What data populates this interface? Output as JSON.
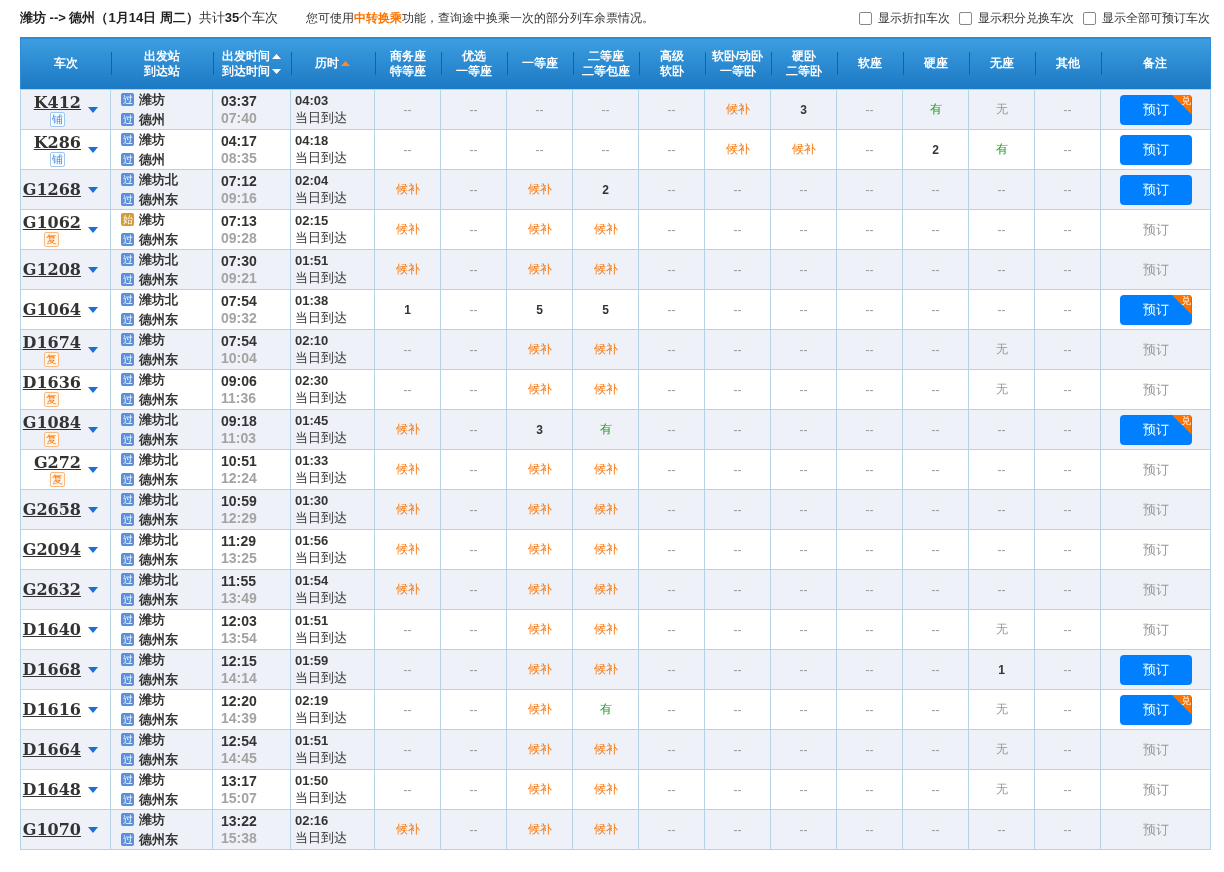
{
  "summary": "**潍坊 --> 德州（1月14日  周二）**共计**35**个车次",
  "notice": {
    "before": "您可使用",
    "link": "中转换乘",
    "after": "功能，查询途中换乘一次的部分列车余票情况。"
  },
  "filters": [
    {
      "label": "显示折扣车次",
      "checked": false
    },
    {
      "label": "显示积分兑换车次",
      "checked": false
    },
    {
      "label": "显示全部可预订车次",
      "checked": false
    }
  ],
  "columns": [
    {
      "lines": [
        "车次"
      ],
      "sortable": false,
      "sorted": false
    },
    {
      "lines": [
        "出发站",
        "到达站"
      ],
      "sortable": false,
      "sorted": false
    },
    {
      "lines": [
        "出发时间",
        "到达时间"
      ],
      "sortable": true,
      "sorted": false
    },
    {
      "lines": [
        "历时"
      ],
      "sortable": false,
      "sorted": true
    },
    {
      "lines": [
        "商务座",
        "特等座"
      ],
      "sortable": false,
      "sorted": false
    },
    {
      "lines": [
        "优选",
        "一等座"
      ],
      "sortable": false,
      "sorted": false
    },
    {
      "lines": [
        "一等座"
      ],
      "sortable": false,
      "sorted": false
    },
    {
      "lines": [
        "二等座",
        "二等包座"
      ],
      "sortable": false,
      "sorted": false
    },
    {
      "lines": [
        "高级",
        "软卧"
      ],
      "sortable": false,
      "sorted": false
    },
    {
      "lines": [
        "软卧/动卧",
        "一等卧"
      ],
      "sortable": false,
      "sorted": false
    },
    {
      "lines": [
        "硬卧",
        "二等卧"
      ],
      "sortable": false,
      "sorted": false
    },
    {
      "lines": [
        "软座"
      ],
      "sortable": false,
      "sorted": false
    },
    {
      "lines": [
        "硬座"
      ],
      "sortable": false,
      "sorted": false
    },
    {
      "lines": [
        "无座"
      ],
      "sortable": false,
      "sorted": false
    },
    {
      "lines": [
        "其他"
      ],
      "sortable": false,
      "sorted": false
    },
    {
      "lines": [
        "备注"
      ],
      "sortable": false,
      "sorted": false
    }
  ],
  "rows": [
    {
      "train": "K412",
      "badge": {
        "text": "铺",
        "kind": "sleeper"
      },
      "from": {
        "tag": "过",
        "kind": "pass",
        "name": "潍坊"
      },
      "to": {
        "tag": "过",
        "kind": "pass",
        "name": "德州"
      },
      "depart": "03:37",
      "arrive": "07:40",
      "duration": "04:03",
      "arrival_day": "当日到达",
      "seats": [
        {
          "text": "--",
          "kind": "none"
        },
        {
          "text": "--",
          "kind": "none"
        },
        {
          "text": "--",
          "kind": "none"
        },
        {
          "text": "--",
          "kind": "none"
        },
        {
          "text": "--",
          "kind": "none"
        },
        {
          "text": "候补",
          "kind": "waitlist"
        },
        {
          "text": "3",
          "kind": "count"
        },
        {
          "text": "--",
          "kind": "none"
        },
        {
          "text": "有",
          "kind": "plenty"
        },
        {
          "text": "无",
          "kind": "soldout"
        },
        {
          "text": "--",
          "kind": "none"
        }
      ],
      "booking": {
        "label": "预订",
        "enabled": true,
        "exchange": true,
        "exchange_label": "兑"
      }
    },
    {
      "train": "K286",
      "badge": {
        "text": "铺",
        "kind": "sleeper"
      },
      "from": {
        "tag": "过",
        "kind": "pass",
        "name": "潍坊"
      },
      "to": {
        "tag": "过",
        "kind": "pass",
        "name": "德州"
      },
      "depart": "04:17",
      "arrive": "08:35",
      "duration": "04:18",
      "arrival_day": "当日到达",
      "seats": [
        {
          "text": "--",
          "kind": "none"
        },
        {
          "text": "--",
          "kind": "none"
        },
        {
          "text": "--",
          "kind": "none"
        },
        {
          "text": "--",
          "kind": "none"
        },
        {
          "text": "--",
          "kind": "none"
        },
        {
          "text": "候补",
          "kind": "waitlist"
        },
        {
          "text": "候补",
          "kind": "waitlist"
        },
        {
          "text": "--",
          "kind": "none"
        },
        {
          "text": "2",
          "kind": "count"
        },
        {
          "text": "有",
          "kind": "plenty"
        },
        {
          "text": "--",
          "kind": "none"
        }
      ],
      "booking": {
        "label": "预订",
        "enabled": true,
        "exchange": false
      }
    },
    {
      "train": "G1268",
      "from": {
        "tag": "过",
        "kind": "pass",
        "name": "潍坊北"
      },
      "to": {
        "tag": "过",
        "kind": "pass",
        "name": "德州东"
      },
      "depart": "07:12",
      "arrive": "09:16",
      "duration": "02:04",
      "arrival_day": "当日到达",
      "seats": [
        {
          "text": "候补",
          "kind": "waitlist"
        },
        {
          "text": "--",
          "kind": "none"
        },
        {
          "text": "候补",
          "kind": "waitlist"
        },
        {
          "text": "2",
          "kind": "count"
        },
        {
          "text": "--",
          "kind": "none"
        },
        {
          "text": "--",
          "kind": "none"
        },
        {
          "text": "--",
          "kind": "none"
        },
        {
          "text": "--",
          "kind": "none"
        },
        {
          "text": "--",
          "kind": "none"
        },
        {
          "text": "--",
          "kind": "none"
        },
        {
          "text": "--",
          "kind": "none"
        }
      ],
      "booking": {
        "label": "预订",
        "enabled": true,
        "exchange": false
      }
    },
    {
      "train": "G1062",
      "badge": {
        "text": "复",
        "kind": "resume"
      },
      "from": {
        "tag": "始",
        "kind": "origin",
        "name": "潍坊"
      },
      "to": {
        "tag": "过",
        "kind": "pass",
        "name": "德州东"
      },
      "depart": "07:13",
      "arrive": "09:28",
      "duration": "02:15",
      "arrival_day": "当日到达",
      "seats": [
        {
          "text": "候补",
          "kind": "waitlist"
        },
        {
          "text": "--",
          "kind": "none"
        },
        {
          "text": "候补",
          "kind": "waitlist"
        },
        {
          "text": "候补",
          "kind": "waitlist"
        },
        {
          "text": "--",
          "kind": "none"
        },
        {
          "text": "--",
          "kind": "none"
        },
        {
          "text": "--",
          "kind": "none"
        },
        {
          "text": "--",
          "kind": "none"
        },
        {
          "text": "--",
          "kind": "none"
        },
        {
          "text": "--",
          "kind": "none"
        },
        {
          "text": "--",
          "kind": "none"
        }
      ],
      "booking": {
        "label": "预订",
        "enabled": false
      }
    },
    {
      "train": "G1208",
      "from": {
        "tag": "过",
        "kind": "pass",
        "name": "潍坊北"
      },
      "to": {
        "tag": "过",
        "kind": "pass",
        "name": "德州东"
      },
      "depart": "07:30",
      "arrive": "09:21",
      "duration": "01:51",
      "arrival_day": "当日到达",
      "seats": [
        {
          "text": "候补",
          "kind": "waitlist"
        },
        {
          "text": "--",
          "kind": "none"
        },
        {
          "text": "候补",
          "kind": "waitlist"
        },
        {
          "text": "候补",
          "kind": "waitlist"
        },
        {
          "text": "--",
          "kind": "none"
        },
        {
          "text": "--",
          "kind": "none"
        },
        {
          "text": "--",
          "kind": "none"
        },
        {
          "text": "--",
          "kind": "none"
        },
        {
          "text": "--",
          "kind": "none"
        },
        {
          "text": "--",
          "kind": "none"
        },
        {
          "text": "--",
          "kind": "none"
        }
      ],
      "booking": {
        "label": "预订",
        "enabled": false
      }
    },
    {
      "train": "G1064",
      "from": {
        "tag": "过",
        "kind": "pass",
        "name": "潍坊北"
      },
      "to": {
        "tag": "过",
        "kind": "pass",
        "name": "德州东"
      },
      "depart": "07:54",
      "arrive": "09:32",
      "duration": "01:38",
      "arrival_day": "当日到达",
      "seats": [
        {
          "text": "1",
          "kind": "count"
        },
        {
          "text": "--",
          "kind": "none"
        },
        {
          "text": "5",
          "kind": "count"
        },
        {
          "text": "5",
          "kind": "count"
        },
        {
          "text": "--",
          "kind": "none"
        },
        {
          "text": "--",
          "kind": "none"
        },
        {
          "text": "--",
          "kind": "none"
        },
        {
          "text": "--",
          "kind": "none"
        },
        {
          "text": "--",
          "kind": "none"
        },
        {
          "text": "--",
          "kind": "none"
        },
        {
          "text": "--",
          "kind": "none"
        }
      ],
      "booking": {
        "label": "预订",
        "enabled": true,
        "exchange": true,
        "exchange_label": "兑"
      }
    },
    {
      "train": "D1674",
      "badge": {
        "text": "复",
        "kind": "resume"
      },
      "from": {
        "tag": "过",
        "kind": "pass",
        "name": "潍坊"
      },
      "to": {
        "tag": "过",
        "kind": "pass",
        "name": "德州东"
      },
      "depart": "07:54",
      "arrive": "10:04",
      "duration": "02:10",
      "arrival_day": "当日到达",
      "seats": [
        {
          "text": "--",
          "kind": "none"
        },
        {
          "text": "--",
          "kind": "none"
        },
        {
          "text": "候补",
          "kind": "waitlist"
        },
        {
          "text": "候补",
          "kind": "waitlist"
        },
        {
          "text": "--",
          "kind": "none"
        },
        {
          "text": "--",
          "kind": "none"
        },
        {
          "text": "--",
          "kind": "none"
        },
        {
          "text": "--",
          "kind": "none"
        },
        {
          "text": "--",
          "kind": "none"
        },
        {
          "text": "无",
          "kind": "soldout"
        },
        {
          "text": "--",
          "kind": "none"
        }
      ],
      "booking": {
        "label": "预订",
        "enabled": false
      }
    },
    {
      "train": "D1636",
      "badge": {
        "text": "复",
        "kind": "resume"
      },
      "from": {
        "tag": "过",
        "kind": "pass",
        "name": "潍坊"
      },
      "to": {
        "tag": "过",
        "kind": "pass",
        "name": "德州东"
      },
      "depart": "09:06",
      "arrive": "11:36",
      "duration": "02:30",
      "arrival_day": "当日到达",
      "seats": [
        {
          "text": "--",
          "kind": "none"
        },
        {
          "text": "--",
          "kind": "none"
        },
        {
          "text": "候补",
          "kind": "waitlist"
        },
        {
          "text": "候补",
          "kind": "waitlist"
        },
        {
          "text": "--",
          "kind": "none"
        },
        {
          "text": "--",
          "kind": "none"
        },
        {
          "text": "--",
          "kind": "none"
        },
        {
          "text": "--",
          "kind": "none"
        },
        {
          "text": "--",
          "kind": "none"
        },
        {
          "text": "无",
          "kind": "soldout"
        },
        {
          "text": "--",
          "kind": "none"
        }
      ],
      "booking": {
        "label": "预订",
        "enabled": false
      }
    },
    {
      "train": "G1084",
      "badge": {
        "text": "复",
        "kind": "resume"
      },
      "from": {
        "tag": "过",
        "kind": "pass",
        "name": "潍坊北"
      },
      "to": {
        "tag": "过",
        "kind": "pass",
        "name": "德州东"
      },
      "depart": "09:18",
      "arrive": "11:03",
      "duration": "01:45",
      "arrival_day": "当日到达",
      "seats": [
        {
          "text": "候补",
          "kind": "waitlist"
        },
        {
          "text": "--",
          "kind": "none"
        },
        {
          "text": "3",
          "kind": "count"
        },
        {
          "text": "有",
          "kind": "plenty"
        },
        {
          "text": "--",
          "kind": "none"
        },
        {
          "text": "--",
          "kind": "none"
        },
        {
          "text": "--",
          "kind": "none"
        },
        {
          "text": "--",
          "kind": "none"
        },
        {
          "text": "--",
          "kind": "none"
        },
        {
          "text": "--",
          "kind": "none"
        },
        {
          "text": "--",
          "kind": "none"
        }
      ],
      "booking": {
        "label": "预订",
        "enabled": true,
        "exchange": true,
        "exchange_label": "兑"
      }
    },
    {
      "train": "G272",
      "badge": {
        "text": "复",
        "kind": "resume"
      },
      "from": {
        "tag": "过",
        "kind": "pass",
        "name": "潍坊北"
      },
      "to": {
        "tag": "过",
        "kind": "pass",
        "name": "德州东"
      },
      "depart": "10:51",
      "arrive": "12:24",
      "duration": "01:33",
      "arrival_day": "当日到达",
      "seats": [
        {
          "text": "候补",
          "kind": "waitlist"
        },
        {
          "text": "--",
          "kind": "none"
        },
        {
          "text": "候补",
          "kind": "waitlist"
        },
        {
          "text": "候补",
          "kind": "waitlist"
        },
        {
          "text": "--",
          "kind": "none"
        },
        {
          "text": "--",
          "kind": "none"
        },
        {
          "text": "--",
          "kind": "none"
        },
        {
          "text": "--",
          "kind": "none"
        },
        {
          "text": "--",
          "kind": "none"
        },
        {
          "text": "--",
          "kind": "none"
        },
        {
          "text": "--",
          "kind": "none"
        }
      ],
      "booking": {
        "label": "预订",
        "enabled": false
      }
    },
    {
      "train": "G2658",
      "from": {
        "tag": "过",
        "kind": "pass",
        "name": "潍坊北"
      },
      "to": {
        "tag": "过",
        "kind": "pass",
        "name": "德州东"
      },
      "depart": "10:59",
      "arrive": "12:29",
      "duration": "01:30",
      "arrival_day": "当日到达",
      "seats": [
        {
          "text": "候补",
          "kind": "waitlist"
        },
        {
          "text": "--",
          "kind": "none"
        },
        {
          "text": "候补",
          "kind": "waitlist"
        },
        {
          "text": "候补",
          "kind": "waitlist"
        },
        {
          "text": "--",
          "kind": "none"
        },
        {
          "text": "--",
          "kind": "none"
        },
        {
          "text": "--",
          "kind": "none"
        },
        {
          "text": "--",
          "kind": "none"
        },
        {
          "text": "--",
          "kind": "none"
        },
        {
          "text": "--",
          "kind": "none"
        },
        {
          "text": "--",
          "kind": "none"
        }
      ],
      "booking": {
        "label": "预订",
        "enabled": false
      }
    },
    {
      "train": "G2094",
      "from": {
        "tag": "过",
        "kind": "pass",
        "name": "潍坊北"
      },
      "to": {
        "tag": "过",
        "kind": "pass",
        "name": "德州东"
      },
      "depart": "11:29",
      "arrive": "13:25",
      "duration": "01:56",
      "arrival_day": "当日到达",
      "seats": [
        {
          "text": "候补",
          "kind": "waitlist"
        },
        {
          "text": "--",
          "kind": "none"
        },
        {
          "text": "候补",
          "kind": "waitlist"
        },
        {
          "text": "候补",
          "kind": "waitlist"
        },
        {
          "text": "--",
          "kind": "none"
        },
        {
          "text": "--",
          "kind": "none"
        },
        {
          "text": "--",
          "kind": "none"
        },
        {
          "text": "--",
          "kind": "none"
        },
        {
          "text": "--",
          "kind": "none"
        },
        {
          "text": "--",
          "kind": "none"
        },
        {
          "text": "--",
          "kind": "none"
        }
      ],
      "booking": {
        "label": "预订",
        "enabled": false
      }
    },
    {
      "train": "G2632",
      "from": {
        "tag": "过",
        "kind": "pass",
        "name": "潍坊北"
      },
      "to": {
        "tag": "过",
        "kind": "pass",
        "name": "德州东"
      },
      "depart": "11:55",
      "arrive": "13:49",
      "duration": "01:54",
      "arrival_day": "当日到达",
      "seats": [
        {
          "text": "候补",
          "kind": "waitlist"
        },
        {
          "text": "--",
          "kind": "none"
        },
        {
          "text": "候补",
          "kind": "waitlist"
        },
        {
          "text": "候补",
          "kind": "waitlist"
        },
        {
          "text": "--",
          "kind": "none"
        },
        {
          "text": "--",
          "kind": "none"
        },
        {
          "text": "--",
          "kind": "none"
        },
        {
          "text": "--",
          "kind": "none"
        },
        {
          "text": "--",
          "kind": "none"
        },
        {
          "text": "--",
          "kind": "none"
        },
        {
          "text": "--",
          "kind": "none"
        }
      ],
      "booking": {
        "label": "预订",
        "enabled": false
      }
    },
    {
      "train": "D1640",
      "from": {
        "tag": "过",
        "kind": "pass",
        "name": "潍坊"
      },
      "to": {
        "tag": "过",
        "kind": "pass",
        "name": "德州东"
      },
      "depart": "12:03",
      "arrive": "13:54",
      "duration": "01:51",
      "arrival_day": "当日到达",
      "seats": [
        {
          "text": "--",
          "kind": "none"
        },
        {
          "text": "--",
          "kind": "none"
        },
        {
          "text": "候补",
          "kind": "waitlist"
        },
        {
          "text": "候补",
          "kind": "waitlist"
        },
        {
          "text": "--",
          "kind": "none"
        },
        {
          "text": "--",
          "kind": "none"
        },
        {
          "text": "--",
          "kind": "none"
        },
        {
          "text": "--",
          "kind": "none"
        },
        {
          "text": "--",
          "kind": "none"
        },
        {
          "text": "无",
          "kind": "soldout"
        },
        {
          "text": "--",
          "kind": "none"
        }
      ],
      "booking": {
        "label": "预订",
        "enabled": false
      }
    },
    {
      "train": "D1668",
      "from": {
        "tag": "过",
        "kind": "pass",
        "name": "潍坊"
      },
      "to": {
        "tag": "过",
        "kind": "pass",
        "name": "德州东"
      },
      "depart": "12:15",
      "arrive": "14:14",
      "duration": "01:59",
      "arrival_day": "当日到达",
      "seats": [
        {
          "text": "--",
          "kind": "none"
        },
        {
          "text": "--",
          "kind": "none"
        },
        {
          "text": "候补",
          "kind": "waitlist"
        },
        {
          "text": "候补",
          "kind": "waitlist"
        },
        {
          "text": "--",
          "kind": "none"
        },
        {
          "text": "--",
          "kind": "none"
        },
        {
          "text": "--",
          "kind": "none"
        },
        {
          "text": "--",
          "kind": "none"
        },
        {
          "text": "--",
          "kind": "none"
        },
        {
          "text": "1",
          "kind": "count"
        },
        {
          "text": "--",
          "kind": "none"
        }
      ],
      "booking": {
        "label": "预订",
        "enabled": true,
        "exchange": false
      }
    },
    {
      "train": "D1616",
      "from": {
        "tag": "过",
        "kind": "pass",
        "name": "潍坊"
      },
      "to": {
        "tag": "过",
        "kind": "pass",
        "name": "德州东"
      },
      "depart": "12:20",
      "arrive": "14:39",
      "duration": "02:19",
      "arrival_day": "当日到达",
      "seats": [
        {
          "text": "--",
          "kind": "none"
        },
        {
          "text": "--",
          "kind": "none"
        },
        {
          "text": "候补",
          "kind": "waitlist"
        },
        {
          "text": "有",
          "kind": "plenty"
        },
        {
          "text": "--",
          "kind": "none"
        },
        {
          "text": "--",
          "kind": "none"
        },
        {
          "text": "--",
          "kind": "none"
        },
        {
          "text": "--",
          "kind": "none"
        },
        {
          "text": "--",
          "kind": "none"
        },
        {
          "text": "无",
          "kind": "soldout"
        },
        {
          "text": "--",
          "kind": "none"
        }
      ],
      "booking": {
        "label": "预订",
        "enabled": true,
        "exchange": true,
        "exchange_label": "兑"
      }
    },
    {
      "train": "D1664",
      "from": {
        "tag": "过",
        "kind": "pass",
        "name": "潍坊"
      },
      "to": {
        "tag": "过",
        "kind": "pass",
        "name": "德州东"
      },
      "depart": "12:54",
      "arrive": "14:45",
      "duration": "01:51",
      "arrival_day": "当日到达",
      "seats": [
        {
          "text": "--",
          "kind": "none"
        },
        {
          "text": "--",
          "kind": "none"
        },
        {
          "text": "候补",
          "kind": "waitlist"
        },
        {
          "text": "候补",
          "kind": "waitlist"
        },
        {
          "text": "--",
          "kind": "none"
        },
        {
          "text": "--",
          "kind": "none"
        },
        {
          "text": "--",
          "kind": "none"
        },
        {
          "text": "--",
          "kind": "none"
        },
        {
          "text": "--",
          "kind": "none"
        },
        {
          "text": "无",
          "kind": "soldout"
        },
        {
          "text": "--",
          "kind": "none"
        }
      ],
      "booking": {
        "label": "预订",
        "enabled": false
      }
    },
    {
      "train": "D1648",
      "from": {
        "tag": "过",
        "kind": "pass",
        "name": "潍坊"
      },
      "to": {
        "tag": "过",
        "kind": "pass",
        "name": "德州东"
      },
      "depart": "13:17",
      "arrive": "15:07",
      "duration": "01:50",
      "arrival_day": "当日到达",
      "seats": [
        {
          "text": "--",
          "kind": "none"
        },
        {
          "text": "--",
          "kind": "none"
        },
        {
          "text": "候补",
          "kind": "waitlist"
        },
        {
          "text": "候补",
          "kind": "waitlist"
        },
        {
          "text": "--",
          "kind": "none"
        },
        {
          "text": "--",
          "kind": "none"
        },
        {
          "text": "--",
          "kind": "none"
        },
        {
          "text": "--",
          "kind": "none"
        },
        {
          "text": "--",
          "kind": "none"
        },
        {
          "text": "无",
          "kind": "soldout"
        },
        {
          "text": "--",
          "kind": "none"
        }
      ],
      "booking": {
        "label": "预订",
        "enabled": false
      }
    },
    {
      "train": "G1070",
      "from": {
        "tag": "过",
        "kind": "pass",
        "name": "潍坊"
      },
      "to": {
        "tag": "过",
        "kind": "pass",
        "name": "德州东"
      },
      "depart": "13:22",
      "arrive": "15:38",
      "duration": "02:16",
      "arrival_day": "当日到达",
      "seats": [
        {
          "text": "候补",
          "kind": "waitlist"
        },
        {
          "text": "--",
          "kind": "none"
        },
        {
          "text": "候补",
          "kind": "waitlist"
        },
        {
          "text": "候补",
          "kind": "waitlist"
        },
        {
          "text": "--",
          "kind": "none"
        },
        {
          "text": "--",
          "kind": "none"
        },
        {
          "text": "--",
          "kind": "none"
        },
        {
          "text": "--",
          "kind": "none"
        },
        {
          "text": "--",
          "kind": "none"
        },
        {
          "text": "--",
          "kind": "none"
        },
        {
          "text": "--",
          "kind": "none"
        }
      ],
      "booking": {
        "label": "预订",
        "enabled": false
      }
    }
  ]
}
